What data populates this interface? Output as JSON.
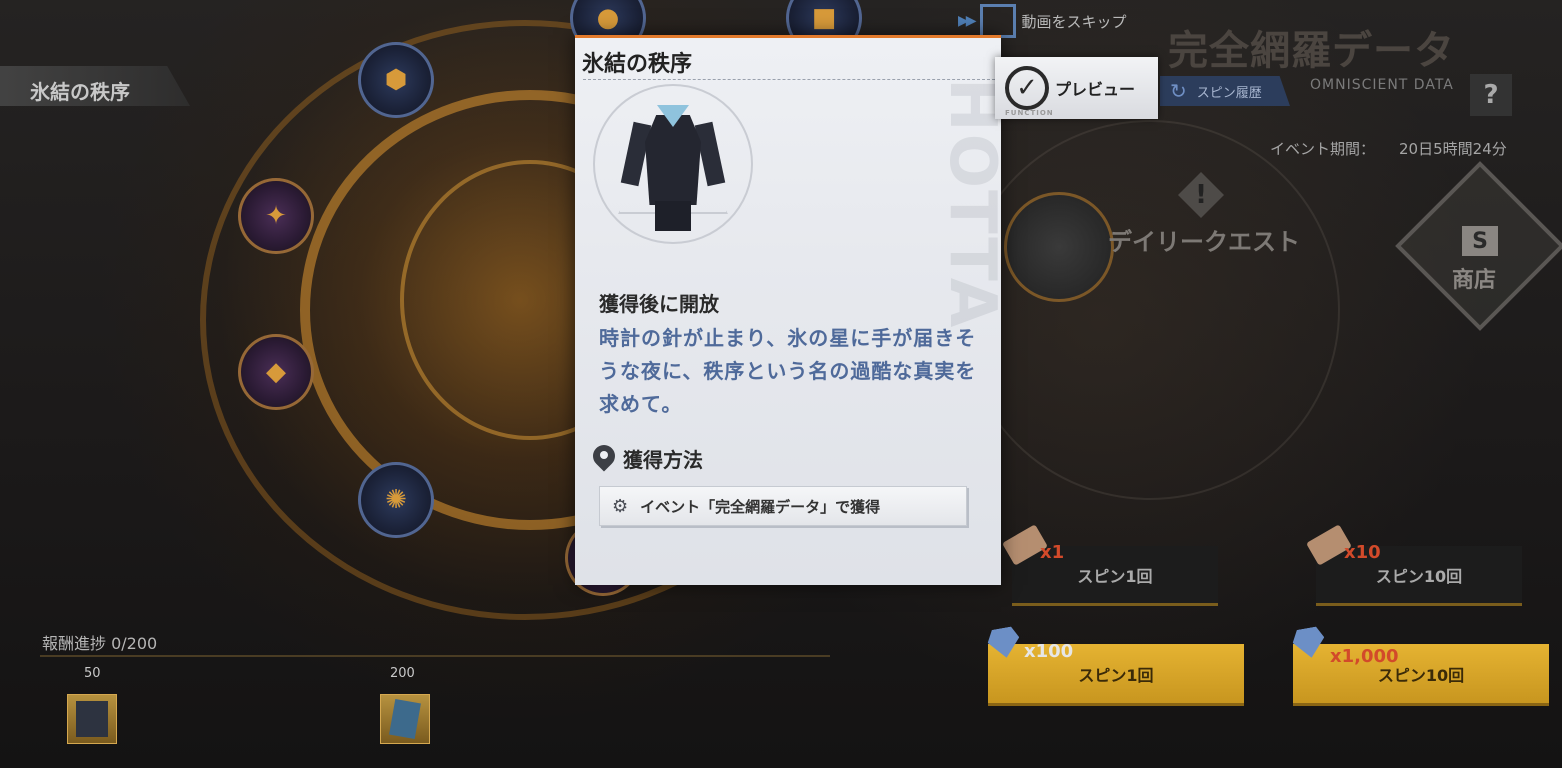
{
  "background": {
    "ribbon_title": "氷結の秩序",
    "skip_label": "動画をスキップ",
    "event_title": "完全網羅データ",
    "event_subtitle": "OMNISCIENT DATA",
    "help_label": "?",
    "spin_history_label": "スピン履歴",
    "event_period_label": "イベント期間：",
    "event_period_value": "20日5時間24分",
    "daily_quest_label": "デイリークエスト",
    "shop_badge": "S",
    "shop_label": "商店"
  },
  "spins": {
    "ticket_x1_cost": "x1",
    "ticket_x1_label": "スピン1回",
    "ticket_x10_cost": "x10",
    "ticket_x10_label": "スピン10回",
    "gem_x100_cost": "x100",
    "gem_x100_label": "スピン1回",
    "gem_x1000_cost": "x1,000",
    "gem_x1000_label": "スピン10回"
  },
  "progress": {
    "label": "報酬進捗",
    "value": "0/200",
    "current": 0,
    "max": 200,
    "markers": [
      "50",
      "200"
    ]
  },
  "popup": {
    "title": "氷結の秩序",
    "unlock_title": "獲得後に開放",
    "description": "時計の針が止まり、氷の星に手が届きそうな夜に、秩序という名の過酷な真実を求めて。",
    "acquire_title": "獲得方法",
    "acquire_method": "イベント「完全網羅データ」で獲得",
    "preview_label": "プレビュー",
    "preview_sub": "FUNCTION"
  },
  "colors": {
    "accent_orange": "#e27a2c",
    "description_blue": "#4f6a9a",
    "gold_button": "#e5b332",
    "cost_red": "#d24a2a"
  }
}
